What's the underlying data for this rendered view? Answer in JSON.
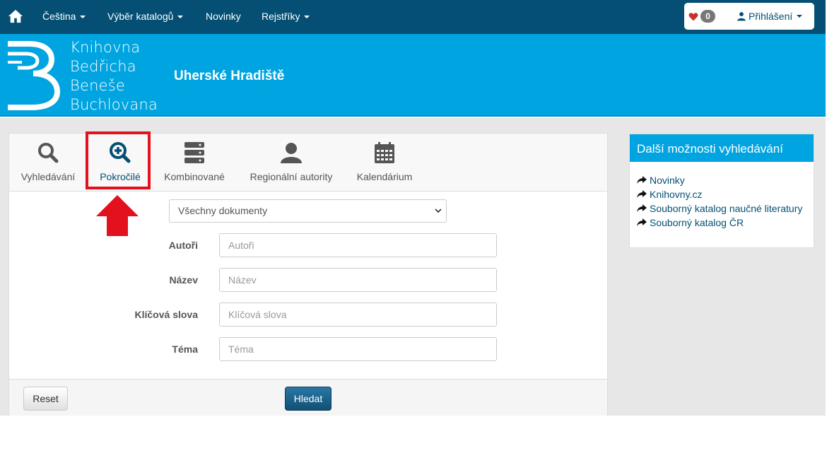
{
  "navbar": {
    "home_icon": "home-icon",
    "items": [
      {
        "label": "Čeština",
        "dropdown": true
      },
      {
        "label": "Výběr katalogů",
        "dropdown": true
      },
      {
        "label": "Novinky",
        "dropdown": false
      },
      {
        "label": "Rejstříky",
        "dropdown": true
      }
    ],
    "favorites_count": "0",
    "login_label": "Přihlášení"
  },
  "header": {
    "logo_lines": [
      "Knihovna",
      "Bedřicha",
      "Beneše",
      "Buchlovana"
    ],
    "city": "Uherské Hradiště"
  },
  "search": {
    "tabs": [
      {
        "label": "Vyhledávání",
        "icon": "search-icon"
      },
      {
        "label": "Pokročilé",
        "icon": "zoom-in-icon",
        "active": true
      },
      {
        "label": "Kombinované",
        "icon": "server-stack-icon"
      },
      {
        "label": "Regionální autority",
        "icon": "user-icon"
      },
      {
        "label": "Kalendárium",
        "icon": "calendar-icon"
      }
    ],
    "document_type": "Všechny dokumenty",
    "fields": [
      {
        "label": "Autoři",
        "placeholder": "Autoři"
      },
      {
        "label": "Název",
        "placeholder": "Název"
      },
      {
        "label": "Klíčová slova",
        "placeholder": "Klíčová slova"
      },
      {
        "label": "Téma",
        "placeholder": "Téma"
      }
    ],
    "reset_label": "Reset",
    "submit_label": "Hledat"
  },
  "sidebar": {
    "title": "Další možnosti vyhledávání",
    "links": [
      "Novinky",
      "Knihovny.cz",
      "Souborný katalog naučné literatury",
      "Souborný katalog ČR"
    ]
  },
  "colors": {
    "navbar": "#044f73",
    "header": "#00a4e0",
    "highlight": "#e3101d"
  }
}
